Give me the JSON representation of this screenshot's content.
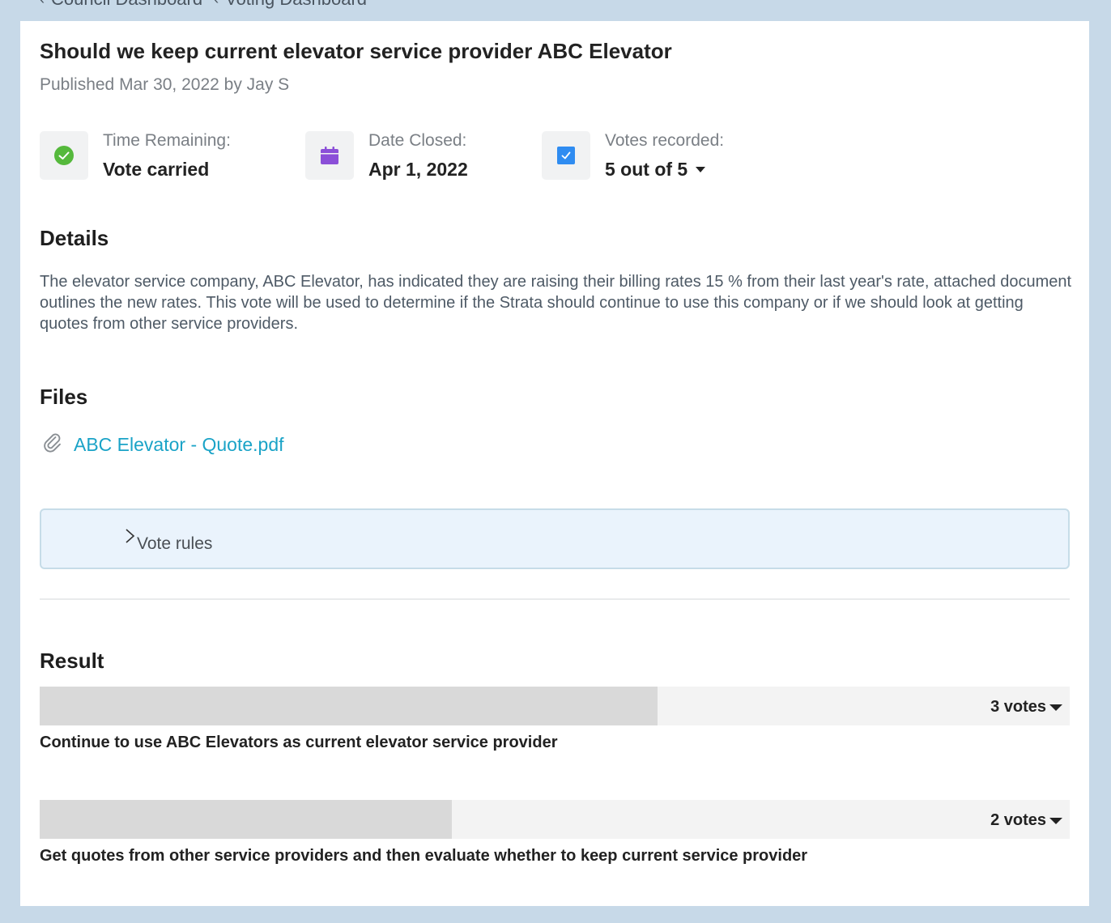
{
  "breadcrumb": [
    {
      "label": "Council Dashboard"
    },
    {
      "label": "Voting Dashboard"
    }
  ],
  "vote": {
    "title": "Should we keep current elevator service provider ABC Elevator",
    "published": "Published Mar 30, 2022 by Jay S"
  },
  "stats": {
    "time_remaining": {
      "label": "Time Remaining:",
      "value": "Vote carried"
    },
    "date_closed": {
      "label": "Date Closed:",
      "value": "Apr 1, 2022"
    },
    "votes_recorded": {
      "label": "Votes recorded:",
      "value": "5 out of 5"
    }
  },
  "details": {
    "heading": "Details",
    "text": "The elevator service company, ABC Elevator, has indicated they are raising their billing rates 15 % from their last year's rate, attached document outlines the new rates. This vote will be used to determine if the Strata should continue to use this company or if we should look at getting quotes from other service providers."
  },
  "files": {
    "heading": "Files",
    "items": [
      {
        "name": "ABC Elevator - Quote.pdf"
      }
    ]
  },
  "vote_rules": {
    "label": "Vote rules"
  },
  "result": {
    "heading": "Result",
    "options": [
      {
        "votes_label": "3 votes",
        "votes": 3,
        "share": 0.6,
        "label": "Continue to use ABC Elevators as current elevator service provider"
      },
      {
        "votes_label": "2 votes",
        "votes": 2,
        "share": 0.4,
        "label": "Get quotes from other service providers and then evaluate whether to keep current service provider"
      }
    ]
  },
  "colors": {
    "page_bg": "#c7d9e8",
    "check_green": "#55b93c",
    "calendar_purple": "#8b4fd8",
    "checkbox_blue": "#2f8cf1",
    "link": "#1aa3c7"
  },
  "icons": {
    "time_remaining": "check-circle-icon",
    "date_closed": "calendar-icon",
    "votes_recorded": "checkbox-icon",
    "file": "paperclip-icon"
  }
}
